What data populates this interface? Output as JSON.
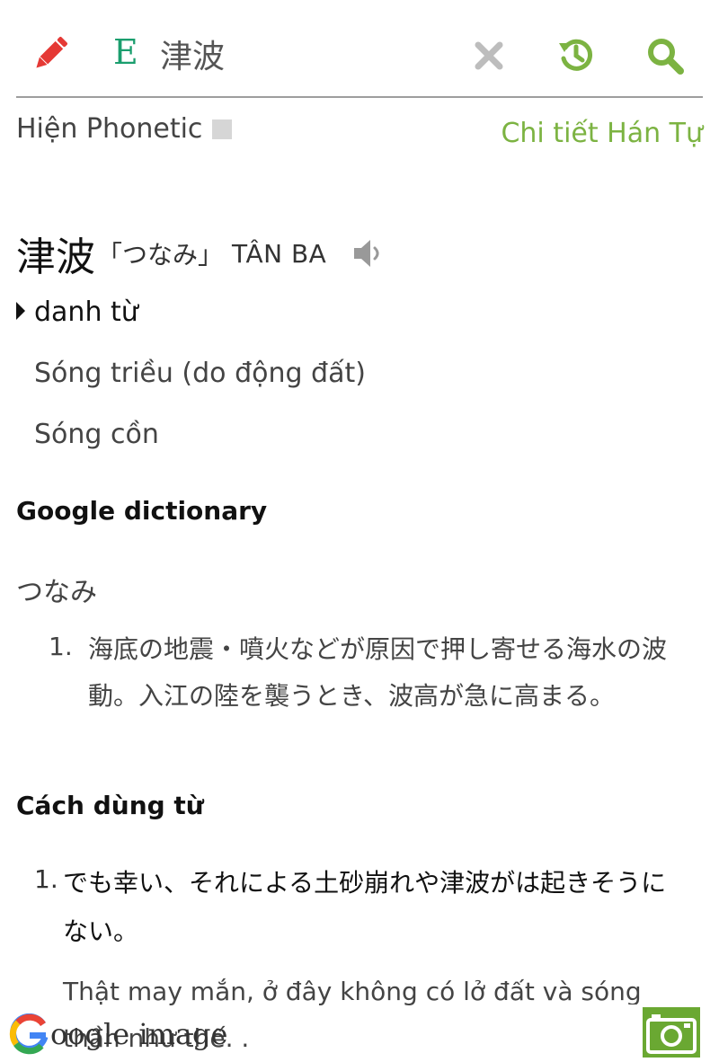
{
  "search": {
    "language": "E",
    "query": "津波"
  },
  "options": {
    "phonetic_label": "Hiện Phonetic",
    "kanji_detail_link": "Chi tiết Hán Tự"
  },
  "entry": {
    "word": "津波",
    "reading": "「つなみ」",
    "han_viet": "TÂN BA",
    "part_of_speech": "danh từ",
    "meanings": [
      "Sóng triều (do động đất)",
      "Sóng cồn"
    ]
  },
  "google_dictionary": {
    "title": "Google dictionary",
    "reading": "つなみ",
    "definitions": [
      {
        "num": "1.",
        "text": "海底の地震・噴火などが原因で押し寄せる海水の波動。入江の陸を襲うとき、波高が急に高まる。"
      }
    ]
  },
  "usage": {
    "title": "Cách dùng từ",
    "examples": [
      {
        "num": "1.",
        "jp": "でも幸い、それによる土砂崩れや津波がは起きそうにない。",
        "vi": "Thật may mắn, ở đây không có lở đất và sóng thần như thế. ."
      }
    ]
  },
  "bottom": {
    "google_image_label": "oogle image"
  },
  "colors": {
    "accent_green": "#7cb342",
    "language_green": "#1a9e6e",
    "pencil_red": "#e53935",
    "clear_gray": "#bdbdbd"
  },
  "icons": {
    "edit": "pencil-icon",
    "clear": "close-icon",
    "history": "history-icon",
    "search": "search-icon",
    "audio": "speaker-icon",
    "camera": "camera-icon"
  }
}
